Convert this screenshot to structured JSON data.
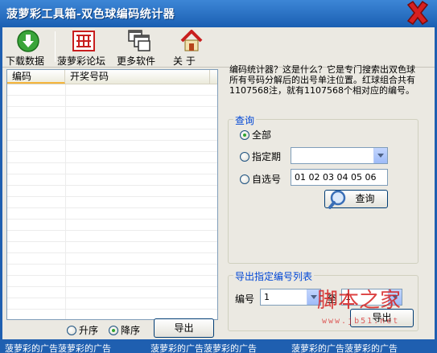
{
  "window": {
    "title": "菠萝彩工具箱-双色球编码统计器"
  },
  "toolbar": {
    "download": "下载数据",
    "forum": "菠萝彩论坛",
    "more": "更多软件",
    "about": "关  于"
  },
  "list": {
    "columns": [
      "编码",
      "开奖号码"
    ],
    "sort_asc": "升序",
    "sort_desc": "降序",
    "export": "导出"
  },
  "description": "编码统计器？这是什么？它是专门搜索出双色球所有号码分解后的出号单注位置。红球组合共有1107568注，就有1107568个相对应的编号。",
  "query": {
    "legend": "查询",
    "all": "全部",
    "period": "指定期",
    "period_value": "",
    "custom": "自选号",
    "custom_value": "01 02 03 04 05 06",
    "button": "查询"
  },
  "export_group": {
    "legend": "导出指定编号列表",
    "label_no": "编号",
    "from_value": "1",
    "label_to": "至",
    "to_value": "1",
    "button": "导出"
  },
  "status": {
    "ads": [
      "菠萝彩的广告菠萝彩的广告",
      "菠萝彩的广告菠萝彩的广告",
      "菠萝彩的广告菠萝彩的广告"
    ]
  },
  "watermark": {
    "text": "脚本之家",
    "url": "www.jb51.net"
  },
  "colors": {
    "title_bar": "#1f5fb0",
    "client": "#ebe9e2",
    "legend": "#0046d5",
    "accent_orange": "#f5b53c"
  }
}
